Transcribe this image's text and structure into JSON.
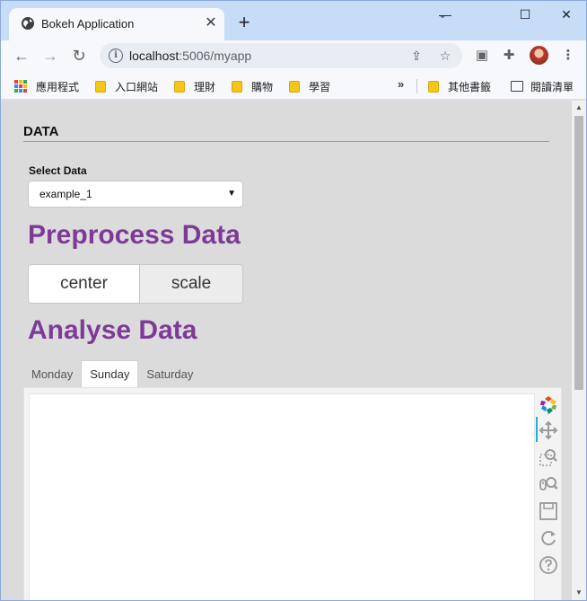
{
  "browser": {
    "tab_title": "Bokeh Application",
    "new_tab_symbol": "+",
    "close_symbol": "✕",
    "url_host": "localhost",
    "url_rest": ":5006/myapp",
    "window_controls": {
      "minimize": "—",
      "maximize": "☐",
      "close": "✕"
    }
  },
  "bookmarks": {
    "items": [
      {
        "label": "應用程式",
        "icon": "apps-grid-icon"
      },
      {
        "label": "入口網站",
        "icon": "folder-icon"
      },
      {
        "label": "理財",
        "icon": "folder-icon"
      },
      {
        "label": "購物",
        "icon": "folder-icon"
      },
      {
        "label": "學習",
        "icon": "folder-icon"
      }
    ],
    "overflow_symbol": "»",
    "other_bookmarks": "其他書籤",
    "reading_list": "閱讀清單"
  },
  "page": {
    "section_title": "DATA",
    "select_label": "Select Data",
    "select_value": "example_1",
    "select_caret": "▼",
    "preprocess_heading": "Preprocess Data",
    "buttons": {
      "center": "center",
      "scale": "scale"
    },
    "analyse_heading": "Analyse Data",
    "tabs": [
      "Monday",
      "Sunday",
      "Saturday"
    ],
    "active_tab": "Sunday"
  },
  "plot_tools": [
    "bokeh-logo-icon",
    "pan-icon",
    "box-zoom-icon",
    "wheel-zoom-icon",
    "save-icon",
    "reset-icon",
    "help-icon"
  ],
  "colors": {
    "heading_purple": "#7d3b97",
    "page_bg": "#dbdbdb",
    "tab_strip": "#c6dcf7",
    "active_tool": "#26aae1"
  }
}
